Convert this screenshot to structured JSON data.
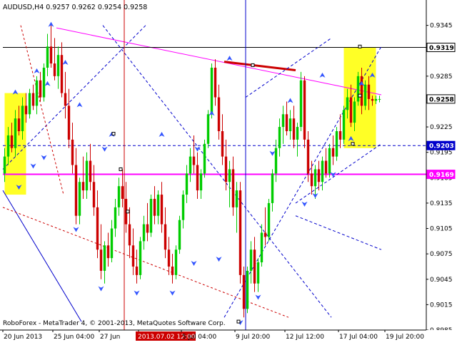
{
  "window": {
    "symbol_header": "AUDUSD,H4  0.9257 0.9262 0.9254 0.9258",
    "copyright": "RoboForex - MetaTrader 4, © 2001-2013, MetaQuotes Software Corp."
  },
  "colors": {
    "background": "#ffffff",
    "bull_candle": "#00cc00",
    "bear_candle": "#cc0000",
    "grid_text": "#000000",
    "zone_fill": "#ffff00",
    "trendline_magenta": "#ff00ff",
    "support_line": "#ff00ff",
    "channel_blue": "#0000cc",
    "dotted_red": "#cc0000",
    "marker_blue": "#3355ff",
    "label_red": "#cc0000"
  },
  "chart_data": {
    "type": "candlestick",
    "symbol": "AUDUSD",
    "timeframe": "H4",
    "ohlc_last": {
      "open": 0.9257,
      "high": 0.9262,
      "low": 0.9254,
      "close": 0.9258
    },
    "ylim": [
      0.8985,
      0.9375
    ],
    "y_ticks": [
      "0.9345",
      "0.9285",
      "0.9225",
      "0.9195",
      "0.9165",
      "0.9135",
      "0.9105",
      "0.9075",
      "0.9045",
      "0.9015",
      "0.8985"
    ],
    "y_tick_values": [
      0.9345,
      0.9285,
      0.9225,
      0.9195,
      0.9165,
      0.9135,
      0.9105,
      0.9075,
      0.9045,
      0.9015,
      0.8985
    ],
    "price_labels": [
      {
        "text": "0.9319",
        "value": 0.9319,
        "style": "hline"
      },
      {
        "text": "0.9258",
        "value": 0.9258,
        "style": "current"
      },
      {
        "text": "0.9203",
        "value": 0.9203,
        "style": "dashed"
      },
      {
        "text": "0.9169",
        "value": 0.9169,
        "style": "support"
      }
    ],
    "x_labels": [
      "20 Jun 2013",
      "25 Jun 04:00",
      "27 Jun",
      "2013.07.02 12:00",
      "5 Jul 04:00",
      "9 Jul 20:00",
      "12 Jul 12:00",
      "17 Jul 04:00",
      "19 Jul 20:00"
    ],
    "x_label_positions": [
      0,
      14,
      27,
      38,
      50,
      65,
      79,
      94,
      107
    ],
    "x_highlight_label": "2013.07.02 12:00",
    "bar_count": 120,
    "candles": [
      [
        0.917,
        0.92,
        0.916,
        0.919
      ],
      [
        0.919,
        0.9225,
        0.918,
        0.9215
      ],
      [
        0.9215,
        0.923,
        0.9195,
        0.92
      ],
      [
        0.92,
        0.9245,
        0.919,
        0.9235
      ],
      [
        0.9235,
        0.925,
        0.9215,
        0.922
      ],
      [
        0.922,
        0.926,
        0.921,
        0.925
      ],
      [
        0.925,
        0.9265,
        0.923,
        0.924
      ],
      [
        0.924,
        0.927,
        0.9235,
        0.9265
      ],
      [
        0.9265,
        0.9275,
        0.9245,
        0.925
      ],
      [
        0.925,
        0.9285,
        0.924,
        0.928
      ],
      [
        0.928,
        0.929,
        0.9255,
        0.926
      ],
      [
        0.926,
        0.93,
        0.9255,
        0.9295
      ],
      [
        0.9295,
        0.9335,
        0.9285,
        0.932
      ],
      [
        0.932,
        0.9345,
        0.9295,
        0.93
      ],
      [
        0.93,
        0.933,
        0.928,
        0.9285
      ],
      [
        0.9285,
        0.932,
        0.927,
        0.931
      ],
      [
        0.931,
        0.9325,
        0.926,
        0.9265
      ],
      [
        0.9265,
        0.929,
        0.9235,
        0.925
      ],
      [
        0.925,
        0.927,
        0.92,
        0.921
      ],
      [
        0.921,
        0.923,
        0.917,
        0.918
      ],
      [
        0.918,
        0.92,
        0.911,
        0.912
      ],
      [
        0.912,
        0.9165,
        0.911,
        0.916
      ],
      [
        0.916,
        0.919,
        0.914,
        0.915
      ],
      [
        0.915,
        0.9195,
        0.914,
        0.9185
      ],
      [
        0.9185,
        0.9205,
        0.915,
        0.916
      ],
      [
        0.916,
        0.918,
        0.912,
        0.913
      ],
      [
        0.913,
        0.915,
        0.907,
        0.908
      ],
      [
        0.908,
        0.911,
        0.9045,
        0.9055
      ],
      [
        0.9055,
        0.909,
        0.904,
        0.9085
      ],
      [
        0.9085,
        0.91,
        0.906,
        0.907
      ],
      [
        0.907,
        0.9115,
        0.9065,
        0.9105
      ],
      [
        0.9105,
        0.914,
        0.9095,
        0.913
      ],
      [
        0.913,
        0.9165,
        0.912,
        0.9155
      ],
      [
        0.9155,
        0.9175,
        0.913,
        0.914
      ],
      [
        0.914,
        0.916,
        0.91,
        0.911
      ],
      [
        0.911,
        0.913,
        0.907,
        0.9085
      ],
      [
        0.9085,
        0.9105,
        0.905,
        0.906
      ],
      [
        0.906,
        0.908,
        0.904,
        0.905
      ],
      [
        0.905,
        0.9095,
        0.9045,
        0.909
      ],
      [
        0.909,
        0.912,
        0.908,
        0.911
      ],
      [
        0.911,
        0.9135,
        0.909,
        0.91
      ],
      [
        0.91,
        0.9145,
        0.9095,
        0.914
      ],
      [
        0.914,
        0.9155,
        0.911,
        0.912
      ],
      [
        0.912,
        0.915,
        0.911,
        0.9145
      ],
      [
        0.9145,
        0.916,
        0.91,
        0.911
      ],
      [
        0.911,
        0.913,
        0.907,
        0.908
      ],
      [
        0.908,
        0.9095,
        0.905,
        0.906
      ],
      [
        0.906,
        0.9075,
        0.904,
        0.905
      ],
      [
        0.905,
        0.9085,
        0.9045,
        0.908
      ],
      [
        0.908,
        0.912,
        0.9075,
        0.9115
      ],
      [
        0.9115,
        0.915,
        0.9105,
        0.9145
      ],
      [
        0.9145,
        0.918,
        0.9135,
        0.917
      ],
      [
        0.917,
        0.92,
        0.916,
        0.919
      ],
      [
        0.919,
        0.9215,
        0.917,
        0.918
      ],
      [
        0.918,
        0.9195,
        0.914,
        0.915
      ],
      [
        0.915,
        0.9175,
        0.914,
        0.917
      ],
      [
        0.917,
        0.921,
        0.9165,
        0.9205
      ],
      [
        0.9205,
        0.9245,
        0.92,
        0.924
      ],
      [
        0.924,
        0.93,
        0.9235,
        0.9295
      ],
      [
        0.9295,
        0.9305,
        0.925,
        0.926
      ],
      [
        0.926,
        0.9275,
        0.921,
        0.922
      ],
      [
        0.922,
        0.924,
        0.918,
        0.919
      ],
      [
        0.919,
        0.921,
        0.915,
        0.916
      ],
      [
        0.916,
        0.9185,
        0.913,
        0.9175
      ],
      [
        0.9175,
        0.919,
        0.912,
        0.913
      ],
      [
        0.913,
        0.916,
        0.91,
        0.915
      ],
      [
        0.915,
        0.916,
        0.904,
        0.905
      ],
      [
        0.905,
        0.906,
        0.9,
        0.901
      ],
      [
        0.901,
        0.906,
        0.9005,
        0.9055
      ],
      [
        0.9055,
        0.909,
        0.904,
        0.908
      ],
      [
        0.908,
        0.9095,
        0.903,
        0.904
      ],
      [
        0.904,
        0.907,
        0.903,
        0.9065
      ],
      [
        0.9065,
        0.911,
        0.906,
        0.91
      ],
      [
        0.91,
        0.913,
        0.9085,
        0.9095
      ],
      [
        0.9095,
        0.914,
        0.909,
        0.9135
      ],
      [
        0.9135,
        0.9175,
        0.9125,
        0.917
      ],
      [
        0.917,
        0.921,
        0.916,
        0.92
      ],
      [
        0.92,
        0.9235,
        0.919,
        0.9225
      ],
      [
        0.9225,
        0.925,
        0.9205,
        0.924
      ],
      [
        0.924,
        0.9255,
        0.9215,
        0.922
      ],
      [
        0.922,
        0.9245,
        0.921,
        0.9235
      ],
      [
        0.9235,
        0.925,
        0.92,
        0.921
      ],
      [
        0.921,
        0.923,
        0.919,
        0.9225
      ],
      [
        0.9225,
        0.929,
        0.922,
        0.928
      ],
      [
        0.928,
        0.9285,
        0.92,
        0.921
      ],
      [
        0.921,
        0.922,
        0.916,
        0.917
      ],
      [
        0.917,
        0.9185,
        0.9145,
        0.9155
      ],
      [
        0.9155,
        0.918,
        0.914,
        0.9175
      ],
      [
        0.9175,
        0.9185,
        0.915,
        0.916
      ],
      [
        0.916,
        0.919,
        0.915,
        0.9185
      ],
      [
        0.9185,
        0.92,
        0.9165,
        0.917
      ],
      [
        0.917,
        0.9205,
        0.9165,
        0.92
      ],
      [
        0.92,
        0.9215,
        0.918,
        0.919
      ],
      [
        0.919,
        0.9225,
        0.9185,
        0.922
      ],
      [
        0.922,
        0.924,
        0.92,
        0.921
      ],
      [
        0.921,
        0.925,
        0.9205,
        0.9245
      ],
      [
        0.9245,
        0.927,
        0.9235,
        0.926
      ],
      [
        0.926,
        0.9275,
        0.9225,
        0.923
      ],
      [
        0.923,
        0.926,
        0.922,
        0.9255
      ],
      [
        0.9255,
        0.929,
        0.925,
        0.9285
      ],
      [
        0.9285,
        0.9295,
        0.924,
        0.925
      ],
      [
        0.925,
        0.928,
        0.9245,
        0.9275
      ],
      [
        0.9275,
        0.9285,
        0.9245,
        0.9258
      ],
      [
        0.9258,
        0.9262,
        0.925,
        0.9256
      ],
      [
        0.9256,
        0.9262,
        0.9252,
        0.9258
      ],
      [
        0.9258,
        0.9262,
        0.9254,
        0.9258
      ]
    ],
    "zones": [
      {
        "name": "left-target-zone",
        "x0": 0.5,
        "x1": 6.5,
        "y0": 0.9145,
        "y1": 0.9265
      },
      {
        "name": "right-target-zone",
        "x0": 95.5,
        "x1": 104.5,
        "y0": 0.92,
        "y1": 0.9319
      }
    ],
    "lines": [
      {
        "name": "resistance-trendline",
        "style": "solid-magenta",
        "x0": 15,
        "y0": 0.9342,
        "x1": 106,
        "y1": 0.9263
      },
      {
        "name": "support-level-0.9169",
        "style": "solid-magenta",
        "x0": 0,
        "y0": 0.9169,
        "x1": 106,
        "y1": 0.9169
      },
      {
        "name": "level-0.9319",
        "style": "solid-black",
        "x0": 0,
        "y0": 0.9319,
        "x1": 106,
        "y1": 0.9319
      },
      {
        "name": "level-0.9203",
        "style": "dashed-blue",
        "x0": 0,
        "y0": 0.9203,
        "x1": 106,
        "y1": 0.9203
      },
      {
        "name": "red-range-top",
        "style": "thick-red",
        "x0": 62,
        "y0": 0.9302,
        "x1": 82,
        "y1": 0.9292
      },
      {
        "name": "channel-upper-left",
        "style": "dashed-blue",
        "x0": 0,
        "y0": 0.9175,
        "x1": 40,
        "y1": 0.9345
      },
      {
        "name": "channel-lower-left",
        "style": "solid-blue",
        "x0": 0,
        "y0": 0.915,
        "x1": 22,
        "y1": 0.8995
      },
      {
        "name": "diag-down-1",
        "style": "dashed-blue",
        "x0": 28,
        "y0": 0.9345,
        "x1": 92,
        "y1": 0.9
      },
      {
        "name": "diag-up-1",
        "style": "dashed-blue",
        "x0": 62,
        "y0": 0.9,
        "x1": 106,
        "y1": 0.932
      },
      {
        "name": "diag-up-2",
        "style": "dashed-blue",
        "x0": 68,
        "y0": 0.926,
        "x1": 92,
        "y1": 0.933
      },
      {
        "name": "diag-dotted-red",
        "style": "dotted-red",
        "x0": 0,
        "y0": 0.913,
        "x1": 80,
        "y1": 0.9
      },
      {
        "name": "diag-dotted-red-steep",
        "style": "dotted-red",
        "x0": 5,
        "y0": 0.9345,
        "x1": 17,
        "y1": 0.9145
      },
      {
        "name": "right-fan-1",
        "style": "dashed-blue",
        "x0": 82,
        "y0": 0.912,
        "x1": 106,
        "y1": 0.908
      },
      {
        "name": "right-fan-2",
        "style": "dashed-blue",
        "x0": 82,
        "y0": 0.9135,
        "x1": 106,
        "y1": 0.9205
      }
    ],
    "vlines": [
      {
        "name": "vline-red-2013-07-02",
        "x": 34,
        "style": "red"
      },
      {
        "name": "vline-blue",
        "x": 68,
        "style": "blue"
      }
    ],
    "fractal_markers": [
      {
        "x": 3,
        "y": 0.9265
      },
      {
        "x": 9,
        "y": 0.929
      },
      {
        "x": 12,
        "y": 0.9275
      },
      {
        "x": 13,
        "y": 0.9345
      },
      {
        "x": 17,
        "y": 0.93
      },
      {
        "x": 21,
        "y": 0.925
      },
      {
        "x": 28,
        "y": 0.92
      },
      {
        "x": 30,
        "y": 0.9215
      },
      {
        "x": 44,
        "y": 0.9215
      },
      {
        "x": 54,
        "y": 0.92
      },
      {
        "x": 58,
        "y": 0.924
      },
      {
        "x": 63,
        "y": 0.9305
      },
      {
        "x": 75,
        "y": 0.9195
      },
      {
        "x": 80,
        "y": 0.9255
      },
      {
        "x": 89,
        "y": 0.9285
      },
      {
        "x": 100,
        "y": 0.9275
      },
      {
        "x": 103,
        "y": 0.9285
      },
      {
        "x": 4,
        "y": 0.9155
      },
      {
        "x": 8,
        "y": 0.918
      },
      {
        "x": 11,
        "y": 0.919
      },
      {
        "x": 20,
        "y": 0.9105
      },
      {
        "x": 27,
        "y": 0.9035
      },
      {
        "x": 37,
        "y": 0.903
      },
      {
        "x": 47,
        "y": 0.903
      },
      {
        "x": 53,
        "y": 0.9065
      },
      {
        "x": 60,
        "y": 0.907
      },
      {
        "x": 66,
        "y": 0.8995
      },
      {
        "x": 71,
        "y": 0.9025
      },
      {
        "x": 84,
        "y": 0.9135
      },
      {
        "x": 87,
        "y": 0.9145
      },
      {
        "x": 92,
        "y": 0.917
      },
      {
        "x": 97,
        "y": 0.921
      }
    ],
    "square_points": [
      {
        "x": 31,
        "y": 0.9217
      },
      {
        "x": 33,
        "y": 0.9175
      },
      {
        "x": 35,
        "y": 0.9125
      },
      {
        "x": 66,
        "y": 0.8995
      },
      {
        "x": 70,
        "y": 0.9298
      },
      {
        "x": 98,
        "y": 0.9205
      },
      {
        "x": 100,
        "y": 0.932
      },
      {
        "x": 100,
        "y": 0.9262
      }
    ]
  }
}
